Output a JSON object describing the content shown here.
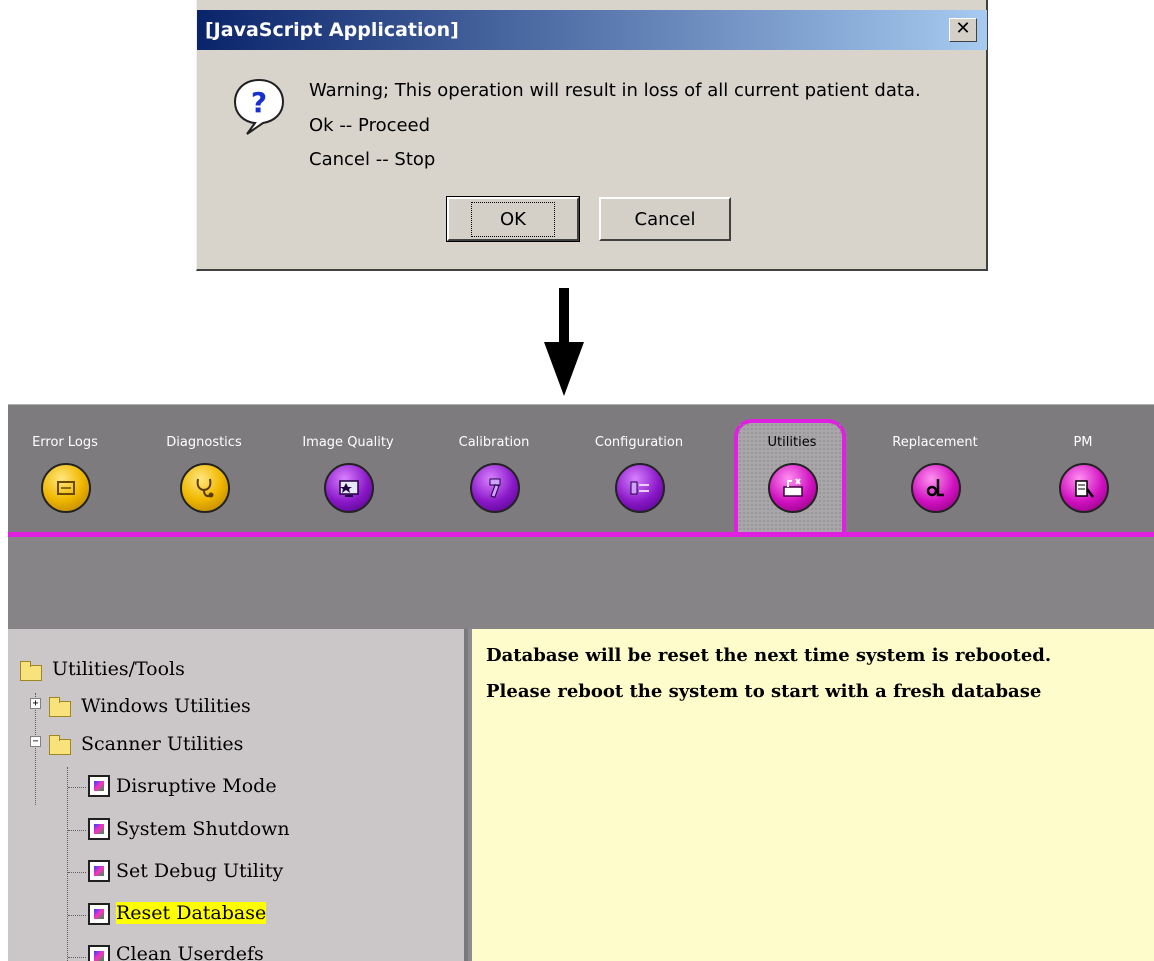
{
  "dialog": {
    "title": "[JavaScript Application]",
    "close_glyph": "✕",
    "lines": [
      "Warning; This operation will result in loss of all current patient data.",
      "Ok -- Proceed",
      "Cancel -- Stop"
    ],
    "ok_label": "OK",
    "cancel_label": "Cancel",
    "icon": "question-icon"
  },
  "arrow": {
    "icon": "down-arrow-icon"
  },
  "tabs": [
    {
      "label": "Error Logs",
      "icon": "error-log-icon",
      "color": "#f0b800",
      "active": false
    },
    {
      "label": "Diagnostics",
      "icon": "stethoscope-icon",
      "color": "#f0b800",
      "active": false
    },
    {
      "label": "Image Quality",
      "icon": "image-quality-icon",
      "color": "#8a18c8",
      "active": false
    },
    {
      "label": "Calibration",
      "icon": "calibration-icon",
      "color": "#8a18c8",
      "active": false
    },
    {
      "label": "Configuration",
      "icon": "configuration-icon",
      "color": "#8a18c8",
      "active": false
    },
    {
      "label": "Utilities",
      "icon": "utilities-icon",
      "color": "#d010c0",
      "active": true
    },
    {
      "label": "Replacement",
      "icon": "replacement-icon",
      "color": "#d010c0",
      "active": false
    },
    {
      "label": "PM",
      "icon": "pm-icon",
      "color": "#d010c0",
      "active": false
    }
  ],
  "tree": {
    "root": "Utilities/Tools",
    "groups": [
      {
        "label": "Windows Utilities",
        "expanded": false
      },
      {
        "label": "Scanner Utilities",
        "expanded": true
      }
    ],
    "items": [
      "Disruptive Mode",
      "System Shutdown",
      "Set Debug Utility",
      "Reset Database",
      "Clean Userdefs"
    ],
    "selected": "Reset Database"
  },
  "content": {
    "lines": [
      "Database will be reset the next time system is rebooted.",
      "Please reboot the system to start with a fresh database"
    ]
  },
  "colors": {
    "accent": "#e020e0",
    "title_bar_start": "#0a246a",
    "title_bar_end": "#a6caf0",
    "content_bg": "#fffccc",
    "selection": "#ffff00"
  }
}
